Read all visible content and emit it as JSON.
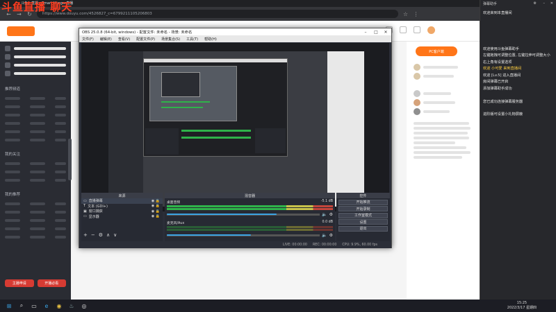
{
  "browser": {
    "tab_title": "斗鱼 - 直播 - Smart Hunger直播",
    "url": "https://www.douyu.com/4526827_c=6799211105206803",
    "watermark": "斗鱼直播 聊天"
  },
  "obs": {
    "title": "OBS 25.0.8 (64-bit, windows) - 配置文件: 未命名 - 场景: 未命名",
    "menu": [
      "文件(F)",
      "编辑(E)",
      "查看(V)",
      "配置文件(P)",
      "场景集合(S)",
      "工具(T)",
      "帮助(H)"
    ],
    "docks": {
      "scenes": "来源",
      "mixer": "混音器",
      "controls": "控件"
    },
    "sources": [
      "直播弹幕",
      "文本 (GDI+)",
      "窗口捕获",
      "显示器"
    ],
    "mixer_channels": [
      {
        "name": "桌面音频",
        "db": "-5.1 dB",
        "level": 0.72
      },
      {
        "name": "麦克风/Aux",
        "db": "0.0 dB",
        "level": 0.55
      }
    ],
    "controls": [
      "开始推流",
      "开始录制",
      "工作室模式",
      "设置",
      "退出"
    ],
    "status": {
      "live": "LIVE:",
      "live_time": "00:00:00",
      "rec": "REC:",
      "rec_time": "00:00:00",
      "cpu": "CPU: 9.9%, 60.00 fps"
    }
  },
  "site": {
    "orange_button": "PC客户端",
    "left_sections": [
      "推荐频道",
      "我的关注",
      "我的推荐"
    ],
    "left_buttons": [
      "主播申请",
      "开播必看"
    ]
  },
  "chat": {
    "title": "弹幕助手",
    "system_line": "欢迎来到本直播间",
    "messages": [
      {
        "text": "欢迎使用斗鱼弹幕助手",
        "hl": false
      },
      {
        "text": "左键拖拽可调整位置, 左键拉伸可调整大小",
        "hl": false
      },
      {
        "text": "右上角有设置选项",
        "hl": false
      },
      {
        "text": "欢迎 小可爱 来到直播间",
        "hl": true
      },
      {
        "text": "欢迎 [Lv.5] 进入直播间",
        "hl": false
      },
      {
        "text": "房间弹幕已开启",
        "hl": false
      },
      {
        "text": "添加弹幕助手成功",
        "hl": false
      },
      {
        "text": "您已成功连接弹幕服务器",
        "hl": false
      },
      {
        "text": "进阶版可设置小礼物屏蔽",
        "hl": false
      }
    ]
  },
  "taskbar": {
    "time": "15:25",
    "date": "2022/3/17 星期四"
  },
  "colors": {
    "accent": "#ff7518",
    "douyu_red": "#d63b33",
    "obs_bg": "#2b2e38"
  }
}
